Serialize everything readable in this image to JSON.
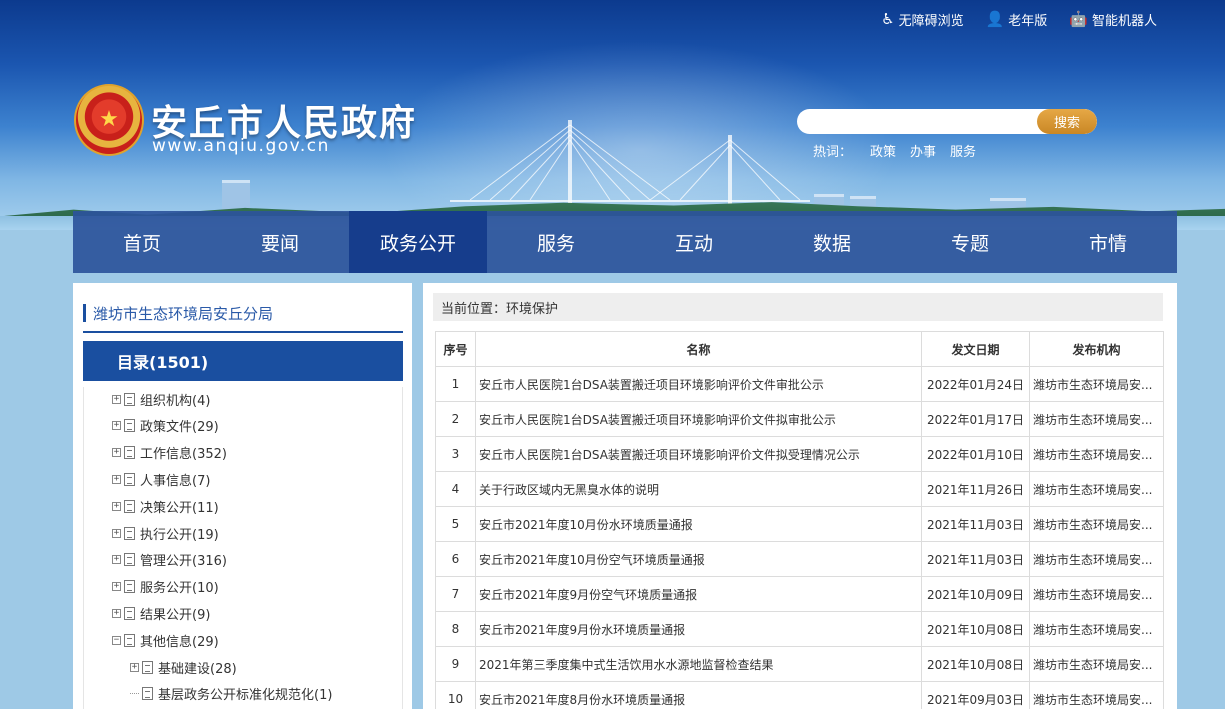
{
  "header": {
    "top_links": [
      {
        "icon": "wheelchair-icon",
        "glyph": "♿",
        "label": "无障碍浏览"
      },
      {
        "icon": "elderly-icon",
        "glyph": "👤",
        "label": "老年版"
      },
      {
        "icon": "robot-icon",
        "glyph": "🤖",
        "label": "智能机器人"
      }
    ],
    "site_title": "安丘市人民政府",
    "site_url": "www.anqiu.gov.cn",
    "search": {
      "placeholder": "",
      "button_label": "搜索"
    },
    "hot_words_label": "热词：",
    "hot_words": [
      "政策",
      "办事",
      "服务"
    ]
  },
  "nav": {
    "items": [
      "首页",
      "要闻",
      "政务公开",
      "服务",
      "互动",
      "数据",
      "专题",
      "市情"
    ],
    "active_index": 2
  },
  "sidebar": {
    "department": "潍坊市生态环境局安丘分局",
    "catalog_title": "目录(1501)",
    "tree": [
      {
        "label": "组织机构(4)",
        "level": 0,
        "expander": "+"
      },
      {
        "label": "政策文件(29)",
        "level": 0,
        "expander": "+"
      },
      {
        "label": "工作信息(352)",
        "level": 0,
        "expander": "+"
      },
      {
        "label": "人事信息(7)",
        "level": 0,
        "expander": "+"
      },
      {
        "label": "决策公开(11)",
        "level": 0,
        "expander": "+"
      },
      {
        "label": "执行公开(19)",
        "level": 0,
        "expander": "+"
      },
      {
        "label": "管理公开(316)",
        "level": 0,
        "expander": "+"
      },
      {
        "label": "服务公开(10)",
        "level": 0,
        "expander": "+"
      },
      {
        "label": "结果公开(9)",
        "level": 0,
        "expander": "+"
      },
      {
        "label": "其他信息(29)",
        "level": 0,
        "expander": "-"
      },
      {
        "label": "基础建设(28)",
        "level": 1,
        "expander": "+"
      },
      {
        "label": "基层政务公开标准化规范化(1)",
        "level": 1,
        "expander": ""
      }
    ]
  },
  "main": {
    "breadcrumb": "当前位置：环境保护",
    "columns": [
      "序号",
      "名称",
      "发文日期",
      "发布机构"
    ],
    "rows": [
      {
        "no": "1",
        "name": "安丘市人民医院1台DSA装置搬迁项目环境影响评价文件审批公示",
        "date": "2022年01月24日",
        "org": "潍坊市生态环境局安..."
      },
      {
        "no": "2",
        "name": "安丘市人民医院1台DSA装置搬迁项目环境影响评价文件拟审批公示",
        "date": "2022年01月17日",
        "org": "潍坊市生态环境局安..."
      },
      {
        "no": "3",
        "name": "安丘市人民医院1台DSA装置搬迁项目环境影响评价文件拟受理情况公示",
        "date": "2022年01月10日",
        "org": "潍坊市生态环境局安..."
      },
      {
        "no": "4",
        "name": "关于行政区域内无黑臭水体的说明",
        "date": "2021年11月26日",
        "org": "潍坊市生态环境局安..."
      },
      {
        "no": "5",
        "name": "安丘市2021年度10月份水环境质量通报",
        "date": "2021年11月03日",
        "org": "潍坊市生态环境局安..."
      },
      {
        "no": "6",
        "name": "安丘市2021年度10月份空气环境质量通报",
        "date": "2021年11月03日",
        "org": "潍坊市生态环境局安..."
      },
      {
        "no": "7",
        "name": "安丘市2021年度9月份空气环境质量通报",
        "date": "2021年10月09日",
        "org": "潍坊市生态环境局安..."
      },
      {
        "no": "8",
        "name": "安丘市2021年度9月份水环境质量通报",
        "date": "2021年10月08日",
        "org": "潍坊市生态环境局安..."
      },
      {
        "no": "9",
        "name": "2021年第三季度集中式生活饮用水水源地监督检查结果",
        "date": "2021年10月08日",
        "org": "潍坊市生态环境局安..."
      },
      {
        "no": "10",
        "name": "安丘市2021年度8月份水环境质量通报",
        "date": "2021年09月03日",
        "org": "潍坊市生态环境局安..."
      }
    ]
  }
}
